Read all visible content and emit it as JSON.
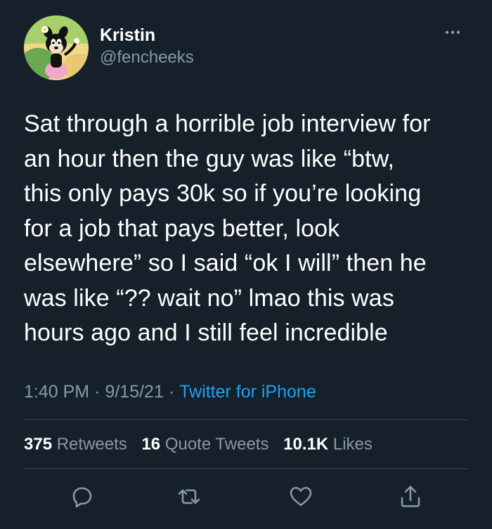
{
  "user": {
    "display_name": "Kristin",
    "handle": "@fencheeks",
    "avatar_icon": "cartoon-character-avatar"
  },
  "tweet": {
    "text": "Sat through a horrible job interview for\nan hour then the guy was like “btw,\nthis only pays 30k so if you’re looking\nfor a job that pays better, look\nelsewhere” so I said “ok I will” then he\nwas like “?? wait no” lmao this was\nhours ago and I still feel incredible",
    "time": "1:40 PM",
    "date": "9/15/21",
    "separator": "·",
    "source": "Twitter for iPhone"
  },
  "stats": {
    "retweets_count": "375",
    "retweets_label": "Retweets",
    "quotes_count": "16",
    "quotes_label": "Quote Tweets",
    "likes_count": "10.1K",
    "likes_label": "Likes"
  },
  "actions": {
    "reply_icon": "reply-icon",
    "retweet_icon": "retweet-icon",
    "like_icon": "heart-icon",
    "share_icon": "share-icon"
  },
  "colors": {
    "background": "#15202b",
    "text": "#ffffff",
    "secondary": "#8899a6",
    "accent": "#1da1f2",
    "divider": "#38444d"
  }
}
